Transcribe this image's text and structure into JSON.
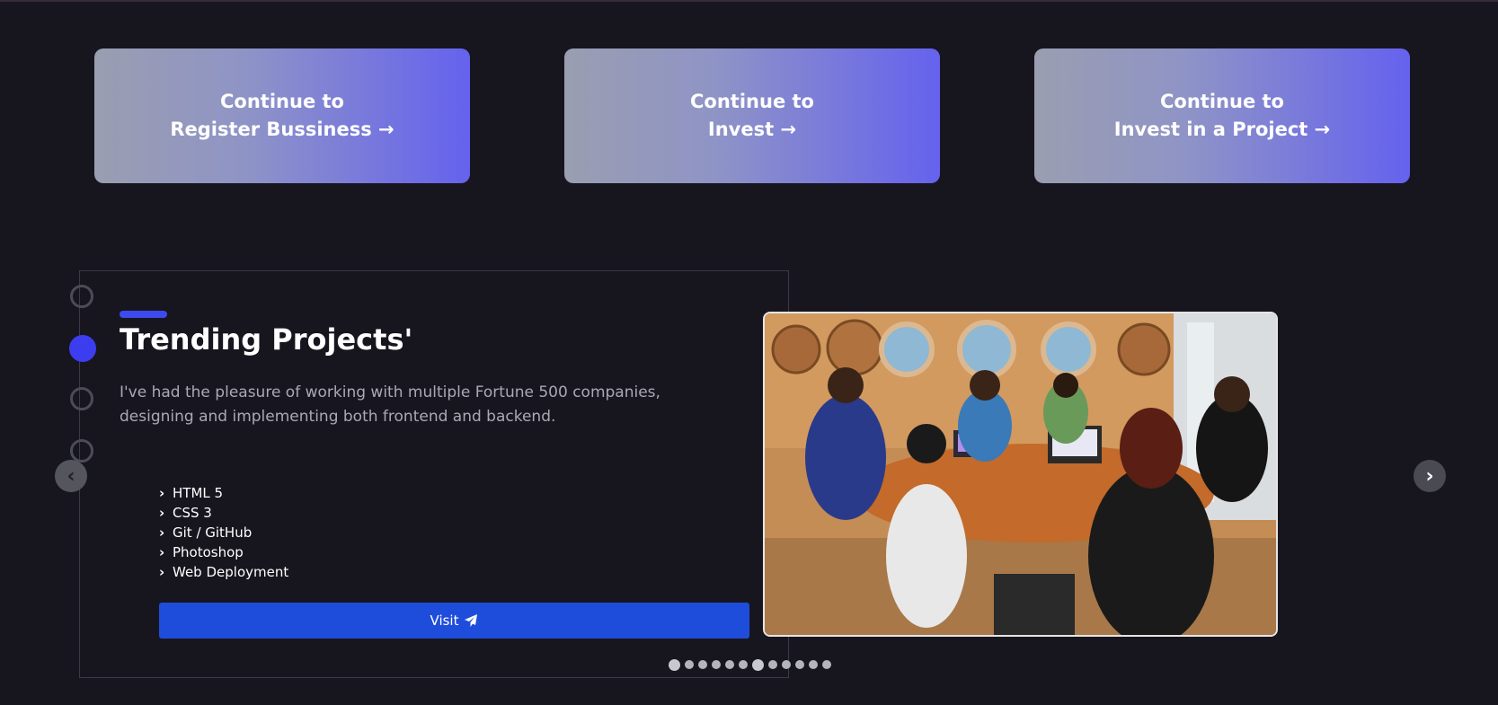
{
  "cta_cards": [
    {
      "line1": "Continue to",
      "line2": "Register Bussiness →"
    },
    {
      "line1": "Continue to",
      "line2": "Invest →"
    },
    {
      "line1": "Continue to",
      "line2": "Invest in a Project →"
    }
  ],
  "project": {
    "heading": "Trending Projects'",
    "description": "I've had the pleasure of working with multiple Fortune 500 companies, designing and implementing both frontend and backend.",
    "skills": [
      "HTML 5",
      "CSS 3",
      "Git / GitHub",
      "Photoshop",
      "Web Deployment"
    ],
    "visit_label": "Visit",
    "visit_icon": "paper-plane-icon"
  },
  "steps": {
    "count": 4,
    "active_index": 1
  },
  "carousel": {
    "dot_count": 12,
    "active_dot": 6,
    "prev_icon": "chevron-left-icon",
    "next_icon": "chevron-right-icon"
  },
  "colors": {
    "accent": "#3d4af0",
    "button": "#1f4ddb",
    "background": "#17161f",
    "cta_gradient_end": "#6562ee"
  }
}
